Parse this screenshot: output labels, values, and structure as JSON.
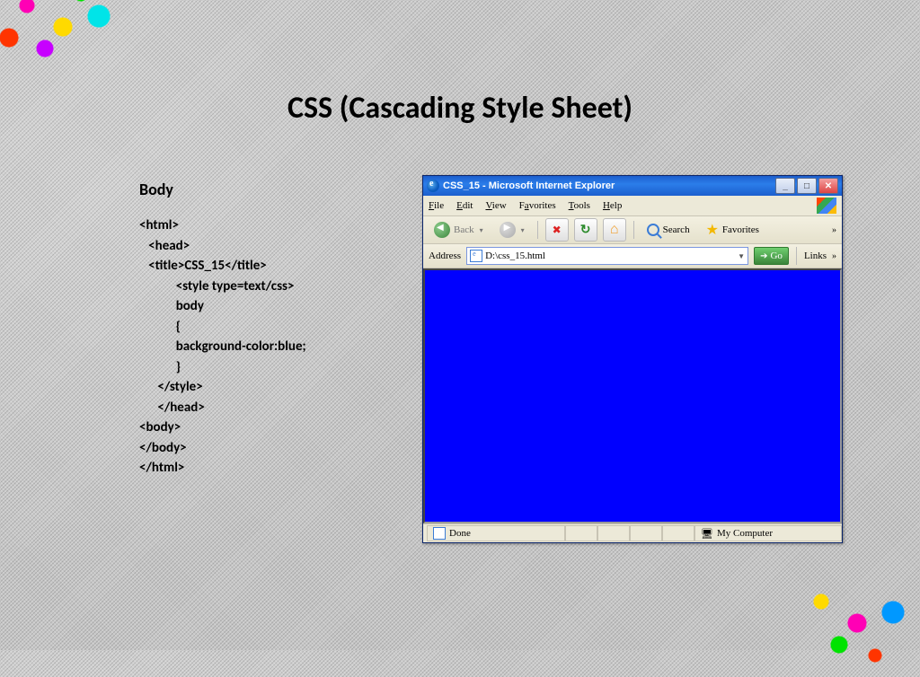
{
  "slide": {
    "title": "CSS (Cascading Style Sheet)",
    "subtitle": "Body",
    "code": "<html>\n   <head>\n   <title>CSS_15</title>\n            <style type=text/css>\n            body\n            {\n            background-color:blue;\n            }\n      </style>\n      </head>\n<body>\n</body>\n</html>"
  },
  "browser": {
    "title": "CSS_15 - Microsoft Internet Explorer",
    "menu": {
      "file": "File",
      "edit": "Edit",
      "view": "View",
      "favorites": "Favorites",
      "tools": "Tools",
      "help": "Help"
    },
    "toolbar": {
      "back": "Back",
      "search": "Search",
      "favorites": "Favorites"
    },
    "address": {
      "label": "Address",
      "value": "D:\\css_15.html",
      "go": "Go",
      "links": "Links"
    },
    "status": {
      "done": "Done",
      "zone": "My Computer"
    }
  }
}
